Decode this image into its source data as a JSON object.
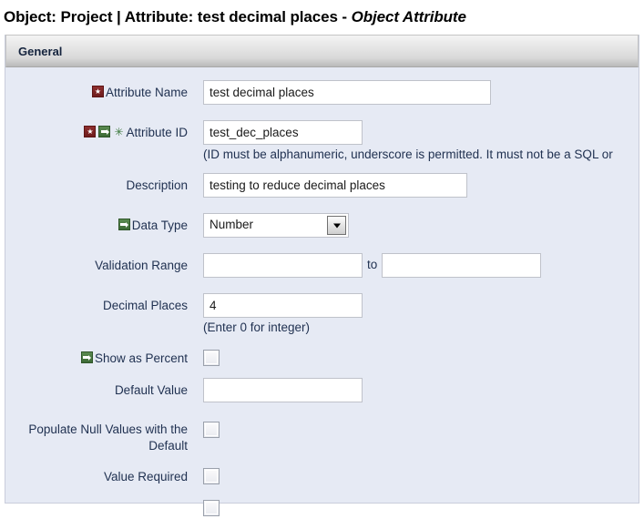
{
  "title": {
    "prefix": "Object: Project | Attribute: test decimal places - ",
    "emphasis": "Object Attribute"
  },
  "section": {
    "header_label": "General"
  },
  "fields": {
    "attribute_name": {
      "label": "Attribute Name",
      "value": "test decimal places",
      "placeholder": ""
    },
    "attribute_id": {
      "label": "Attribute ID",
      "value": "test_dec_places",
      "placeholder": "",
      "help": "(ID must be alphanumeric, underscore is permitted. It must not be a SQL or"
    },
    "description": {
      "label": "Description",
      "value": "testing to reduce decimal places",
      "placeholder": ""
    },
    "data_type": {
      "label": "Data Type",
      "value": "Number"
    },
    "validation_range": {
      "label": "Validation Range",
      "from_value": "",
      "to_value": "",
      "separator": "to",
      "placeholder": ""
    },
    "decimal_places": {
      "label": "Decimal Places",
      "value": "4",
      "placeholder": "",
      "help": "(Enter 0 for integer)"
    },
    "show_as_percent": {
      "label": "Show as Percent",
      "checked": false
    },
    "default_value": {
      "label": "Default Value",
      "value": "",
      "placeholder": ""
    },
    "populate_null_values": {
      "label_line1": "Populate Null Values with the",
      "label_line2": "Default",
      "checked": false
    },
    "value_required": {
      "label": "Value Required",
      "checked": false
    }
  },
  "icons": {
    "required": "required-star-icon",
    "inherited": "green-arrow-icon",
    "unique": "green-asterisk-icon"
  },
  "colors": {
    "panel_background": "#e6eaf4",
    "label_text": "#1f3050",
    "required_badge": "#6d1c1c",
    "inherited_badge": "#3d6b36",
    "unique_badge": "#3d7a3d",
    "input_border": "#bfc2ca",
    "header_gradient_top": "#f4f4f4",
    "header_gradient_bottom": "#b9b9b9"
  }
}
